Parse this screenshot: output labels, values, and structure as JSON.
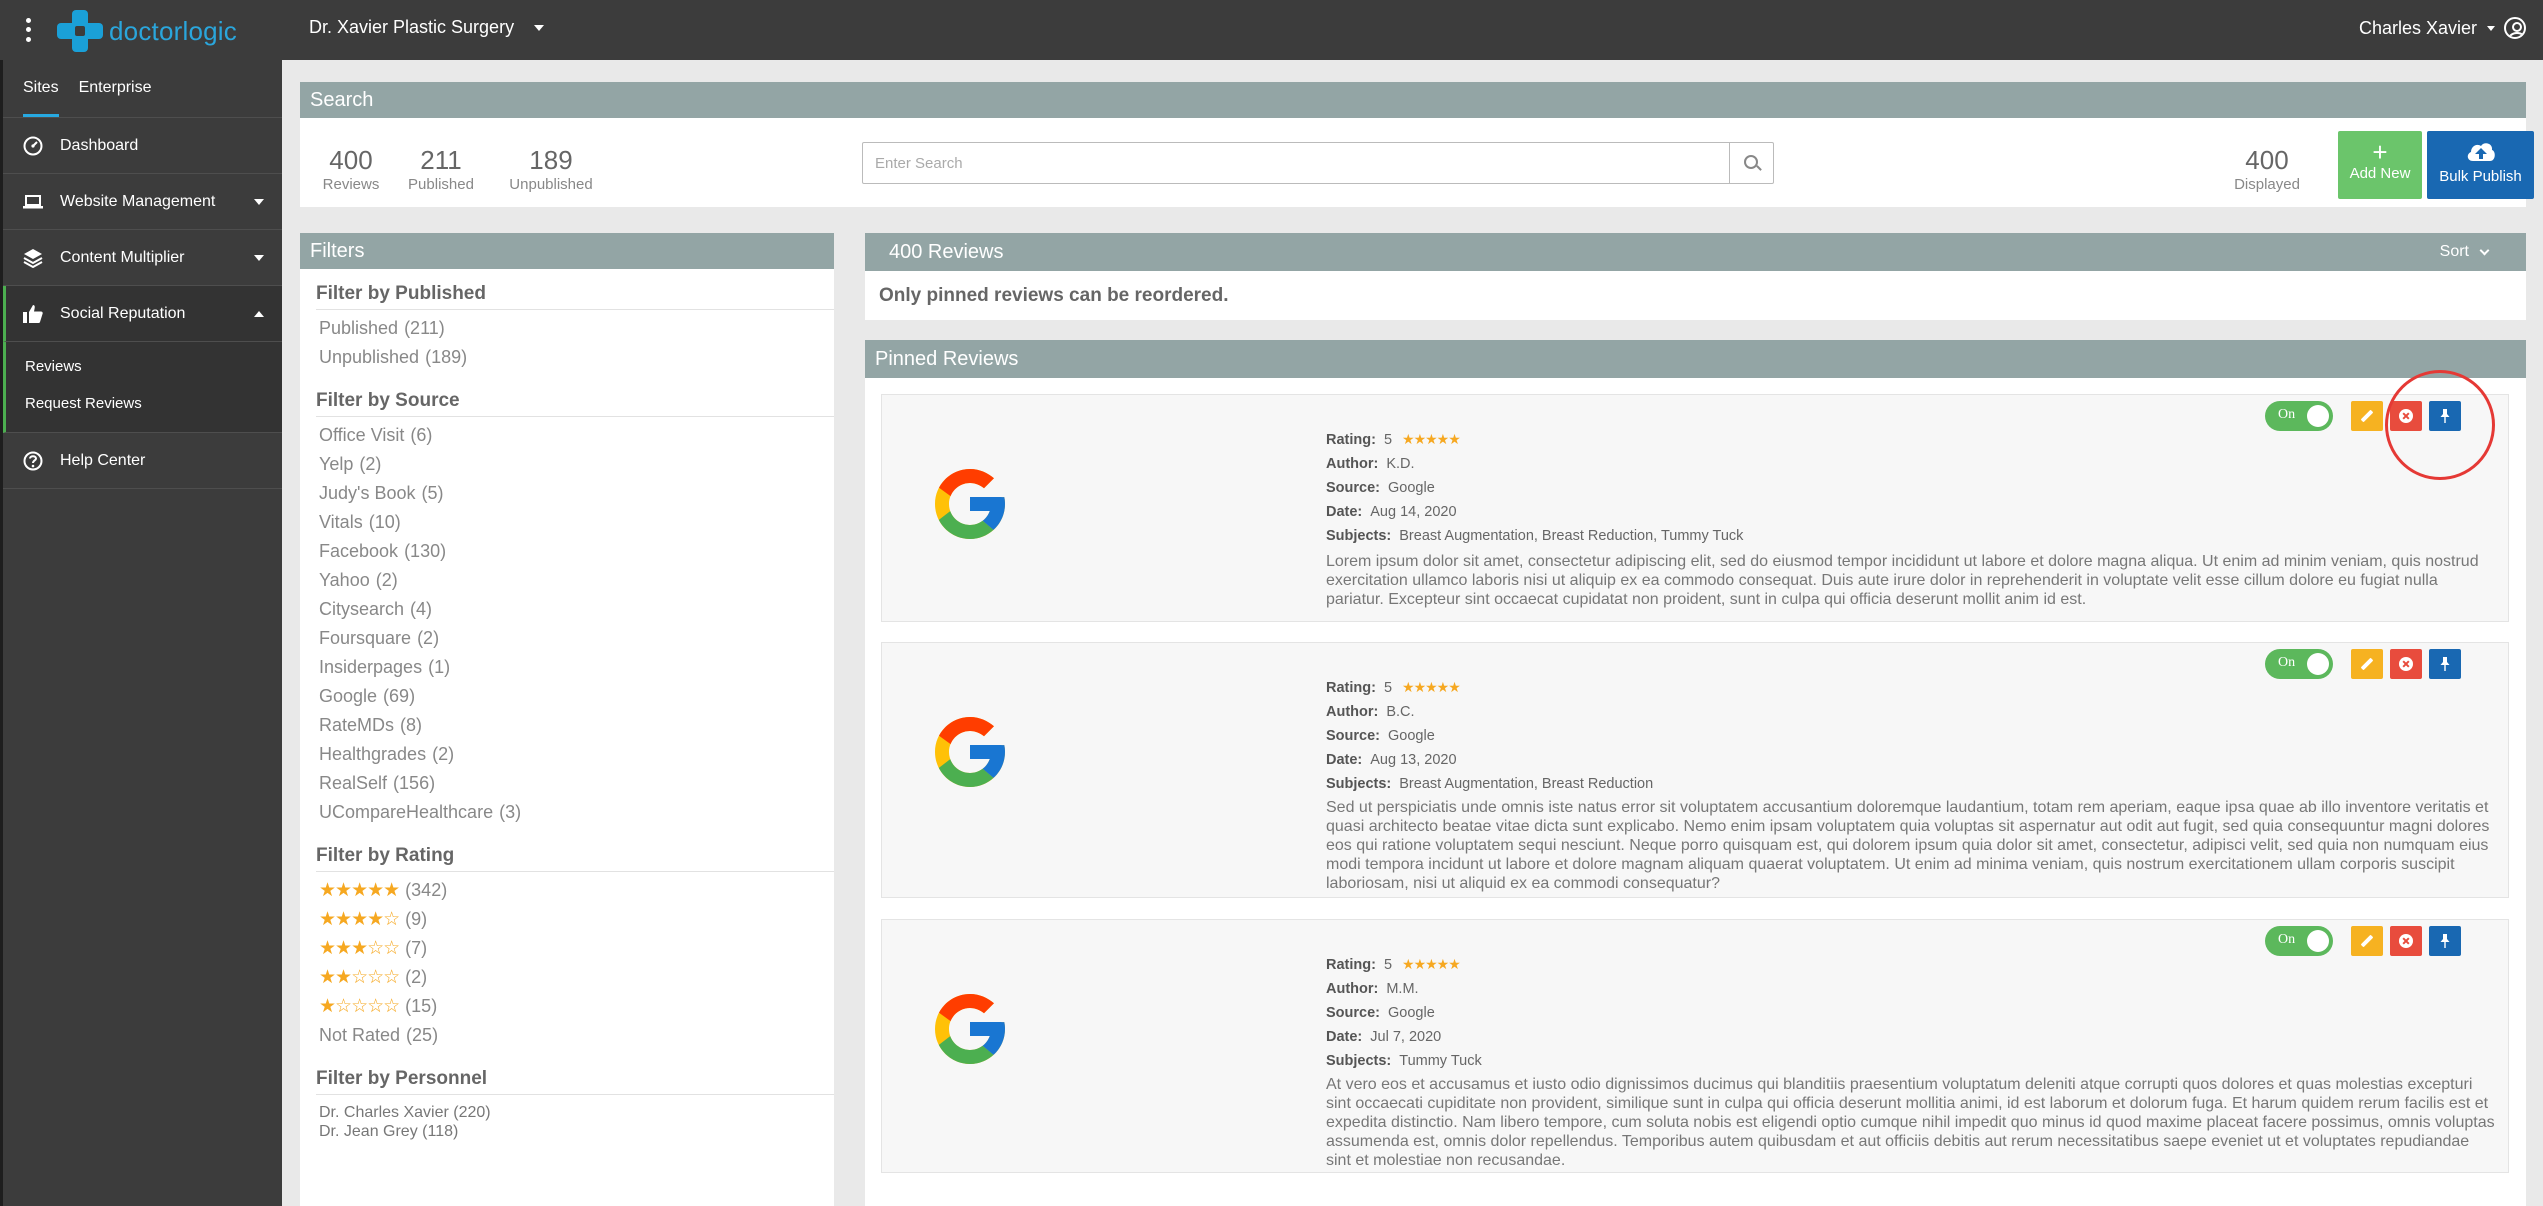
{
  "app": {
    "logo_text": "doctorlogic"
  },
  "topbar": {
    "site_name": "Dr. Xavier Plastic Surgery",
    "user_name": "Charles Xavier"
  },
  "sidebar": {
    "tabs": [
      "Sites",
      "Enterprise"
    ],
    "items": [
      {
        "label": "Dashboard",
        "icon": "dashboard-icon"
      },
      {
        "label": "Website Management",
        "icon": "laptop-icon"
      },
      {
        "label": "Content Multiplier",
        "icon": "layers-icon"
      },
      {
        "label": "Social Reputation",
        "icon": "thumbs-up-icon"
      },
      {
        "label": "Help Center",
        "icon": "help-circle-icon"
      }
    ],
    "sub_items": [
      "Reviews",
      "Request Reviews"
    ]
  },
  "search": {
    "header": "Search",
    "stats": [
      {
        "value": "400",
        "label": "Reviews"
      },
      {
        "value": "211",
        "label": "Published"
      },
      {
        "value": "189",
        "label": "Unpublished"
      }
    ],
    "placeholder": "Enter Search",
    "displayed": {
      "value": "400",
      "label": "Displayed"
    },
    "add_new_label": "Add New",
    "add_new_symbol": "+",
    "bulk_publish_label": "Bulk Publish"
  },
  "filters": {
    "header": "Filters",
    "published": {
      "title": "Filter by Published",
      "items": [
        {
          "label": "Published",
          "count": "(211)"
        },
        {
          "label": "Unpublished",
          "count": "(189)"
        }
      ]
    },
    "source": {
      "title": "Filter by Source",
      "items": [
        {
          "label": "Office Visit",
          "count": "(6)"
        },
        {
          "label": "Yelp",
          "count": "(2)"
        },
        {
          "label": "Judy's Book",
          "count": "(5)"
        },
        {
          "label": "Vitals",
          "count": "(10)"
        },
        {
          "label": "Facebook",
          "count": "(130)"
        },
        {
          "label": "Yahoo",
          "count": "(2)"
        },
        {
          "label": "Citysearch",
          "count": "(4)"
        },
        {
          "label": "Foursquare",
          "count": "(2)"
        },
        {
          "label": "Insiderpages",
          "count": "(1)"
        },
        {
          "label": "Google",
          "count": "(69)"
        },
        {
          "label": "RateMDs",
          "count": "(8)"
        },
        {
          "label": "Healthgrades",
          "count": "(2)"
        },
        {
          "label": "RealSelf",
          "count": "(156)"
        },
        {
          "label": "UCompareHealthcare",
          "count": "(3)"
        }
      ]
    },
    "rating": {
      "title": "Filter by Rating",
      "items": [
        {
          "stars": "★★★★★",
          "count": "(342)"
        },
        {
          "stars": "★★★★☆",
          "count": "(9)"
        },
        {
          "stars": "★★★☆☆",
          "count": "(7)"
        },
        {
          "stars": "★★☆☆☆",
          "count": "(2)"
        },
        {
          "stars": "★☆☆☆☆",
          "count": "(15)"
        }
      ],
      "not_rated": {
        "label": "Not Rated",
        "count": "(25)"
      }
    },
    "personnel": {
      "title": "Filter by Personnel",
      "items": [
        "Dr. Charles Xavier (220)",
        "Dr. Jean Grey (118)"
      ]
    }
  },
  "reviews": {
    "header": "400 Reviews",
    "sort_label": "Sort",
    "notice": "Only pinned reviews can be reordered.",
    "pinned_header": "Pinned Reviews",
    "toggle_label": "On",
    "meta_labels": {
      "rating": "Rating:",
      "author": "Author:",
      "source": "Source:",
      "date": "Date:",
      "subjects": "Subjects:"
    },
    "items": [
      {
        "rating": "5",
        "stars": "★★★★★",
        "author": "K.D.",
        "source": "Google",
        "date": "Aug 14, 2020",
        "subjects": "Breast Augmentation, Breast Reduction, Tummy Tuck",
        "text": "Lorem ipsum dolor sit amet, consectetur adipiscing elit, sed do eiusmod tempor incididunt ut labore et dolore magna aliqua. Ut enim ad minim veniam, quis nostrud exercitation ullamco laboris nisi ut aliquip ex ea commodo consequat. Duis aute irure dolor in reprehenderit in voluptate velit esse cillum dolore eu fugiat nulla pariatur. Excepteur sint occaecat cupidatat non proident, sunt in culpa qui officia deserunt mollit anim id est."
      },
      {
        "rating": "5",
        "stars": "★★★★★",
        "author": "B.C.",
        "source": "Google",
        "date": "Aug 13, 2020",
        "subjects": "Breast Augmentation, Breast Reduction",
        "text": "Sed ut perspiciatis unde omnis iste natus error sit voluptatem accusantium doloremque laudantium, totam rem aperiam, eaque ipsa quae ab illo inventore veritatis et quasi architecto beatae vitae dicta sunt explicabo. Nemo enim ipsam voluptatem quia voluptas sit aspernatur aut odit aut fugit, sed quia consequuntur magni dolores eos qui ratione voluptatem sequi nesciunt. Neque porro quisquam est, qui dolorem ipsum quia dolor sit amet, consectetur, adipisci velit, sed quia non numquam eius modi tempora incidunt ut labore et dolore magnam aliquam quaerat voluptatem. Ut enim ad minima veniam, quis nostrum exercitationem ullam corporis suscipit laboriosam, nisi ut aliquid ex ea commodi consequatur?"
      },
      {
        "rating": "5",
        "stars": "★★★★★",
        "author": "M.M.",
        "source": "Google",
        "date": "Jul 7, 2020",
        "subjects": "Tummy Tuck",
        "text": "At vero eos et accusamus et iusto odio dignissimos ducimus qui blanditiis praesentium voluptatum deleniti atque corrupti quos dolores et quas molestias excepturi sint occaecati cupiditate non provident, similique sunt in culpa qui officia deserunt mollitia animi, id est laborum et dolorum fuga. Et harum quidem rerum facilis est et expedita distinctio. Nam libero tempore, cum soluta nobis est eligendi optio cumque nihil impedit quo minus id quod maxime placeat facere possimus, omnis voluptas assumenda est, omnis dolor repellendus. Temporibus autem quibusdam et aut officiis debitis aut rerum necessitatibus saepe eveniet ut et voluptates repudiandae sint et molestiae non recusandae."
      }
    ]
  },
  "colors": {
    "topbar": "#3c3c3c",
    "panel_header": "#93a5a5",
    "brand": "#27a9e1",
    "success": "#6bc56b",
    "primary": "#1968b2",
    "warning": "#f6b221",
    "danger": "#e84c3d",
    "star": "#f6a821",
    "annotation": "#e53935"
  }
}
